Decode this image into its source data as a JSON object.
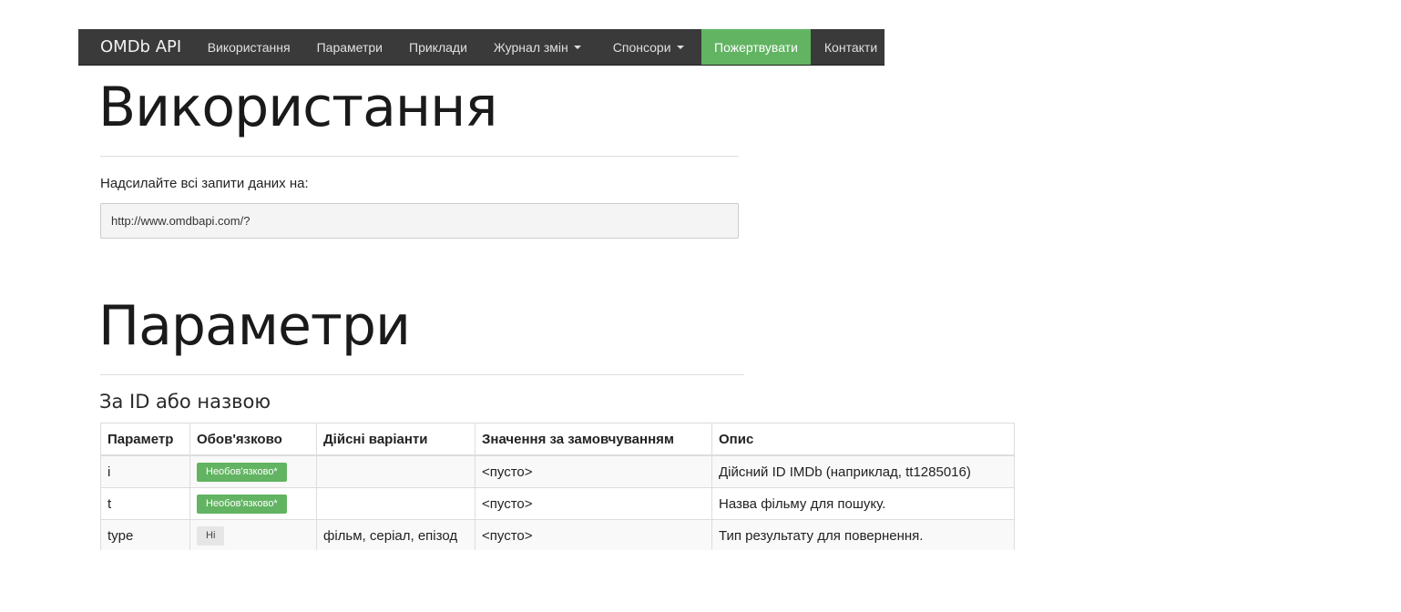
{
  "navbar": {
    "brand": "OMDb API",
    "items": [
      {
        "label": "Використання",
        "dropdown": false
      },
      {
        "label": "Параметри",
        "dropdown": false
      },
      {
        "label": "Приклади",
        "dropdown": false
      },
      {
        "label": "Журнал змін",
        "dropdown": true
      },
      {
        "label": "Спонсори",
        "dropdown": true
      },
      {
        "label": "Пожертвувати",
        "dropdown": false,
        "highlight": "#62b462"
      },
      {
        "label": "Контакти",
        "dropdown": false
      }
    ],
    "background": "#3a3a3a"
  },
  "usage": {
    "title": "Використання",
    "lead": "Надсилайте всі запити даних на:",
    "url": "http://www.omdbapi.com/?"
  },
  "parameters": {
    "title": "Параметри",
    "subheading": "За ID або назвою",
    "table": {
      "headers": [
        "Параметр",
        "Обов'язково",
        "Дійсні варіанти",
        "Значення за замовчуванням",
        "Опис"
      ],
      "rows": [
        {
          "param": "i",
          "required": "Необов'язково*",
          "required_style": "success",
          "options": "",
          "default": "<пусто>",
          "description": "Дійсний ID IMDb (наприклад, tt1285016)"
        },
        {
          "param": "t",
          "required": "Необов'язково*",
          "required_style": "success",
          "options": "",
          "default": "<пусто>",
          "description": "Назва фільму для пошуку."
        },
        {
          "param": "type",
          "required": "Ні",
          "required_style": "default",
          "options": "фільм, серіал, епізод",
          "default": "<пусто>",
          "description": "Тип результату для повернення."
        }
      ]
    }
  },
  "colors": {
    "accent_green": "#62b462",
    "navbar_dark": "#3a3a3a"
  }
}
